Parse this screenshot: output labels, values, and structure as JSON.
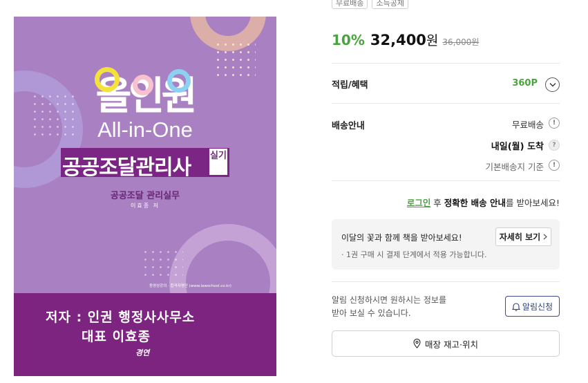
{
  "cover": {
    "logo": "올인원",
    "subtitle_en": "All-in-One",
    "title_ko": "공공조달관리사",
    "title_tag": "실기",
    "subtitle_ko": "공공조달 관리실무",
    "author_small": "이효종 저",
    "publisher_line": "동영상강의 · 합격자명단 (www.lawschool.co.kr)",
    "bottom_line1": "저자 : 인권 행정사사무소",
    "bottom_line2": "대표 이효종",
    "brand": "경연",
    "colors": {
      "top": "#a980c2",
      "bottom": "#7d2481",
      "band": "#7b2585"
    }
  },
  "product": {
    "tags": [
      "무료배송",
      "소득공제"
    ],
    "discount": "10%",
    "price": "32,400",
    "price_unit": "원",
    "original_price": "36,000원",
    "points_label": "적립/혜택",
    "points_value": "360P",
    "shipping_label": "배송안내",
    "shipping_free": "무료배송",
    "arrival": "내일(월) 도착",
    "base_address": "기본배송지 기준",
    "login_link": "로그인",
    "login_mid": " 후 ",
    "login_bold": "정확한 배송 안내",
    "login_tail": "를 받아보세요!",
    "flower_title": "이달의 꽃과 함께 책을 받아보세요!",
    "flower_note": "· 1권 구매 시 결제 단계에서 적용 가능합니다.",
    "detail_button": "자세히 보기",
    "alarm_text_1": "알림 신청하시면 원하시는 정보를",
    "alarm_text_2": "받아 보실 수 있습니다.",
    "alarm_button": "알림신청",
    "store_button": "매장 재고·위치",
    "accent_green": "#4aa33f",
    "accent_navy": "#2c3e80"
  },
  "icons": {
    "chevron": "chevron-down-icon",
    "info": "info-icon",
    "help": "question-icon",
    "bell": "bell-icon",
    "location": "location-pin-icon",
    "arrow": "chevron-right-icon"
  }
}
